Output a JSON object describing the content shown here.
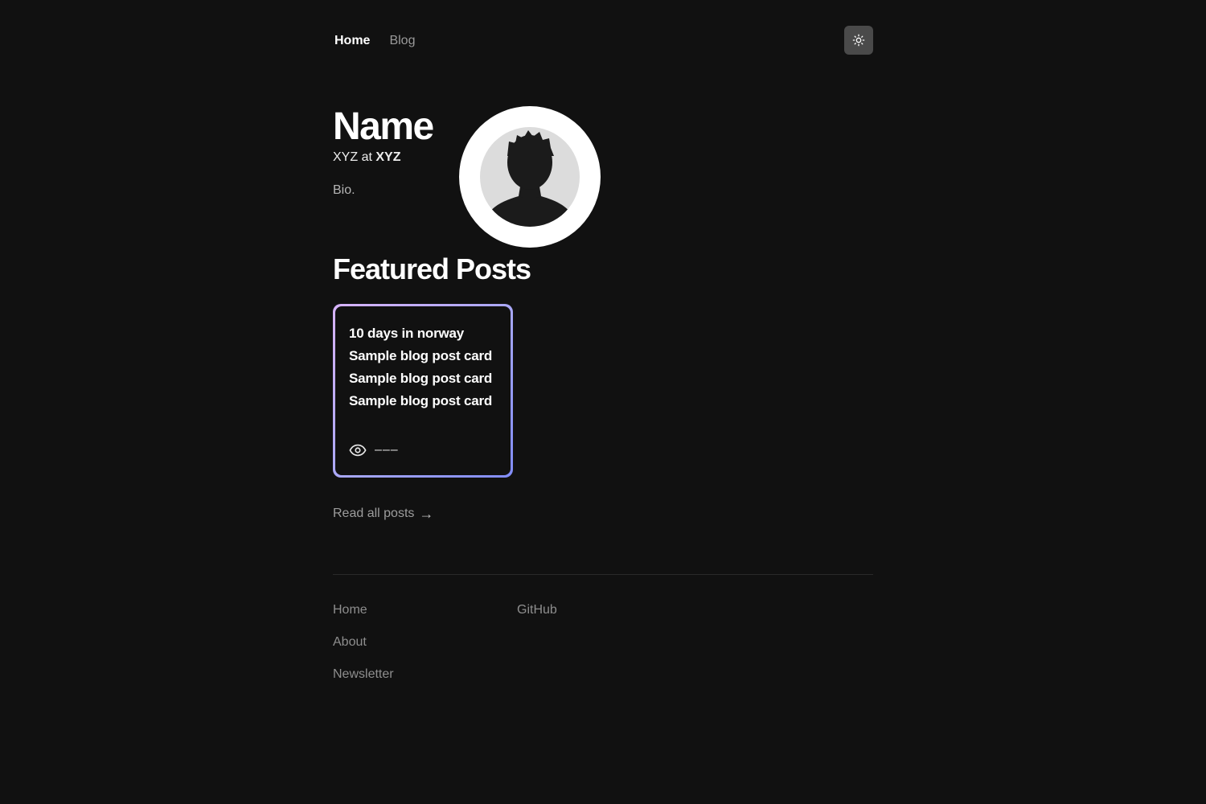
{
  "nav": {
    "items": [
      {
        "label": "Home",
        "active": true
      },
      {
        "label": "Blog",
        "active": false
      }
    ],
    "theme_toggle_icon": "sun-icon"
  },
  "hero": {
    "name": "Name",
    "role_title": "XYZ",
    "role_at": "at",
    "role_company": "XYZ",
    "bio": "Bio.",
    "avatar_icon": "user-silhouette-icon"
  },
  "featured": {
    "title": "Featured Posts",
    "card": {
      "title": "10 days in norway",
      "lines": [
        "Sample blog post card",
        "Sample blog post card",
        "Sample blog post card"
      ],
      "views_icon": "eye-icon",
      "views_count": "–––"
    },
    "read_all": "Read all posts",
    "read_all_icon": "arrow-right-icon"
  },
  "footer": {
    "col1": [
      "Home",
      "About",
      "Newsletter"
    ],
    "col2": [
      "GitHub"
    ]
  },
  "colors": {
    "background": "#111111",
    "gradient_start": "#d8b4fe",
    "gradient_end": "#818cf8",
    "theme_button": "#4a4a4a"
  }
}
